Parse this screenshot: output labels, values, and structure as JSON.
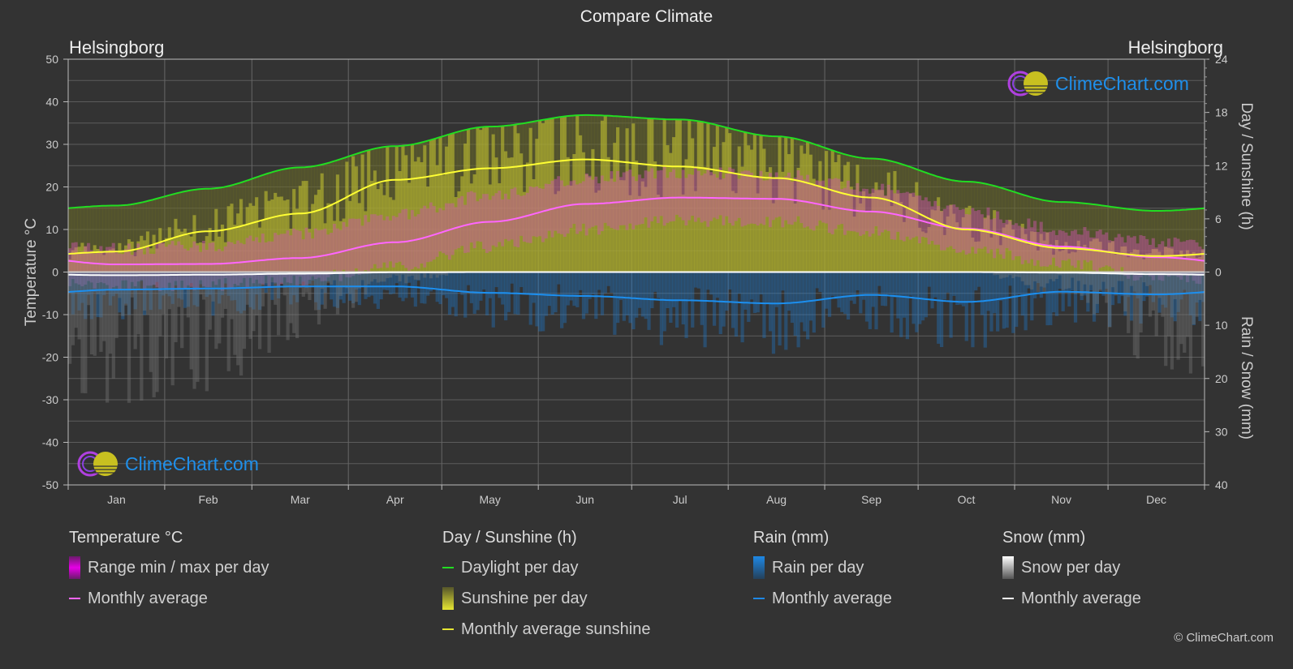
{
  "title": "Compare Climate",
  "location_left": "Helsingborg",
  "location_right": "Helsingborg",
  "watermark": "ClimeChart.com",
  "copyright": "© ClimeChart.com",
  "colors": {
    "background": "#333333",
    "grid": "#5c5c5c",
    "temp_range": "#e600e6",
    "temp_avg": "#ff66ff",
    "daylight": "#22dd22",
    "sunshine_bar": "#c8c832",
    "sunshine_avg": "#ffff33",
    "rain_bar": "#1e7fd6",
    "rain_avg": "#1c8fef",
    "snow_bar": "#dddddd",
    "snow_avg": "#ffffff",
    "watermark": "#1f8fea"
  },
  "legend": {
    "groups": [
      {
        "header": "Temperature °C",
        "items": [
          {
            "type": "box",
            "label": "Range min / max per day",
            "color": "#e600e6"
          },
          {
            "type": "line",
            "label": "Monthly average",
            "color": "#ff66ff"
          }
        ]
      },
      {
        "header": "Day / Sunshine (h)",
        "items": [
          {
            "type": "line",
            "label": "Daylight per day",
            "color": "#22dd22"
          },
          {
            "type": "box",
            "label": "Sunshine per day",
            "color": "#e6e633"
          },
          {
            "type": "line",
            "label": "Monthly average sunshine",
            "color": "#e6e633"
          }
        ]
      },
      {
        "header": "Rain (mm)",
        "items": [
          {
            "type": "box",
            "label": "Rain per day",
            "color": "#1e88e5"
          },
          {
            "type": "line",
            "label": "Monthly average",
            "color": "#1e88e5"
          }
        ]
      },
      {
        "header": "Snow (mm)",
        "items": [
          {
            "type": "box",
            "label": "Snow per day",
            "color": "#ffffff"
          },
          {
            "type": "line",
            "label": "Monthly average",
            "color": "#ffffff"
          }
        ]
      }
    ]
  },
  "chart_data": {
    "type": "line",
    "title": "Compare Climate",
    "categories": [
      "Jan",
      "Feb",
      "Mar",
      "Apr",
      "May",
      "Jun",
      "Jul",
      "Aug",
      "Sep",
      "Oct",
      "Nov",
      "Dec"
    ],
    "axes": {
      "left": {
        "label": "Temperature °C",
        "range": [
          -50,
          50
        ],
        "ticks": [
          50,
          40,
          30,
          20,
          10,
          0,
          -10,
          -20,
          -30,
          -40,
          -50
        ]
      },
      "right_top": {
        "label": "Day / Sunshine (h)",
        "range": [
          0,
          24
        ],
        "ticks": [
          24,
          18,
          12,
          6,
          0
        ]
      },
      "right_bottom": {
        "label": "Rain / Snow (mm)",
        "range": [
          0,
          40
        ],
        "ticks": [
          0,
          10,
          20,
          30,
          40
        ],
        "inverted": true
      }
    },
    "grid": true,
    "series": [
      {
        "name": "Temperature monthly average",
        "unit": "°C",
        "axis": "left",
        "values": [
          1.8,
          1.9,
          3.3,
          7.0,
          11.8,
          16.0,
          17.5,
          17.2,
          14.2,
          10.2,
          6.0,
          3.5
        ]
      },
      {
        "name": "Temperature daily min (approx)",
        "unit": "°C",
        "axis": "left",
        "values": [
          -1.5,
          -1.5,
          -0.5,
          3.0,
          7.5,
          11.5,
          13.5,
          13.5,
          10.8,
          7.0,
          3.5,
          0.5
        ]
      },
      {
        "name": "Temperature daily max (approx)",
        "unit": "°C",
        "axis": "left",
        "values": [
          4.0,
          4.5,
          7.5,
          12.0,
          16.5,
          20.5,
          22.0,
          21.5,
          18.0,
          13.0,
          8.5,
          5.5
        ]
      },
      {
        "name": "Daylight per day",
        "unit": "h",
        "axis": "right_top",
        "values": [
          7.5,
          9.4,
          11.8,
          14.2,
          16.4,
          17.7,
          17.2,
          15.3,
          12.8,
          10.2,
          7.9,
          6.9
        ]
      },
      {
        "name": "Monthly average sunshine",
        "unit": "h",
        "axis": "right_top",
        "values": [
          2.3,
          4.6,
          6.6,
          10.4,
          11.7,
          12.7,
          11.9,
          10.6,
          8.4,
          4.8,
          2.7,
          1.8
        ]
      },
      {
        "name": "Rain monthly average",
        "unit": "mm",
        "axis": "right_bottom",
        "values": [
          3.3,
          3.1,
          2.7,
          2.7,
          3.9,
          4.5,
          5.3,
          5.9,
          4.3,
          5.6,
          3.7,
          4.2
        ]
      },
      {
        "name": "Snow monthly average",
        "unit": "mm",
        "axis": "right_bottom",
        "values": [
          0.6,
          0.5,
          0.3,
          0.05,
          0,
          0,
          0,
          0,
          0,
          0,
          0.1,
          0.4
        ]
      }
    ]
  }
}
